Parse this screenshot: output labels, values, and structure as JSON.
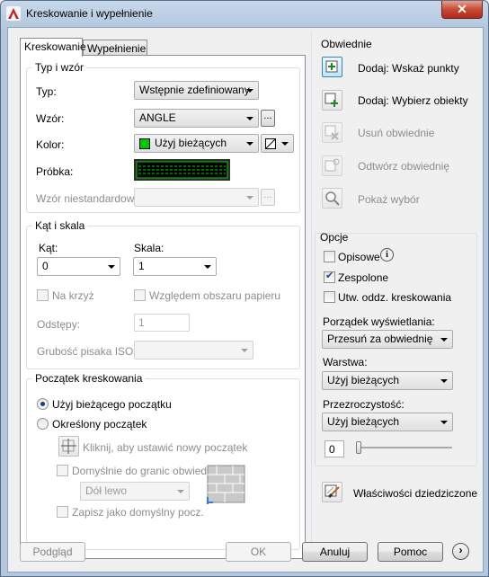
{
  "window": {
    "title": "Kreskowanie i wypełnienie",
    "close": "✕"
  },
  "tabs": [
    {
      "label": "Kreskowanie",
      "active": true
    },
    {
      "label": "Wypełnienie",
      "active": false
    }
  ],
  "type_pattern": {
    "group_title": "Typ i wzór",
    "type_label": "Typ:",
    "type_value": "Wstępnie zdefiniowany",
    "pattern_label": "Wzór:",
    "pattern_value": "ANGLE",
    "ellipsis": "...",
    "color_label": "Kolor:",
    "color_value": "Użyj bieżących",
    "color_swatch": "#00c800",
    "sample_label": "Próbka:",
    "custom_label": "Wzór niestandardowy:",
    "custom_value": ""
  },
  "angle_scale": {
    "group_title": "Kąt i skala",
    "angle_label": "Kąt:",
    "angle_value": "0",
    "scale_label": "Skala:",
    "scale_value": "1",
    "double_label": "Na krzyż",
    "relative_label": "Względem obszaru papieru",
    "spacing_label": "Odstępy:",
    "spacing_value": "1",
    "iso_label": "Grubość pisaka ISO:",
    "iso_value": ""
  },
  "origin": {
    "group_title": "Początek kreskowania",
    "current_label": "Użyj bieżącego początku",
    "specified_label": "Określony początek",
    "click_label": "Kliknij, aby ustawić nowy początek",
    "default_extents_label": "Domyślnie do granic obwiedni",
    "position_value": "Dół lewo",
    "store_label": "Zapisz jako domyślny pocz."
  },
  "boundaries": {
    "title": "Obwiednie",
    "items": [
      {
        "label": "Dodaj: Wskaż punkty",
        "enabled": true
      },
      {
        "label": "Dodaj: Wybierz obiekty",
        "enabled": true
      },
      {
        "label": "Usuń obwiednie",
        "enabled": false
      },
      {
        "label": "Odtwórz obwiednię",
        "enabled": false
      },
      {
        "label": "Pokaż wybór",
        "enabled": false
      }
    ]
  },
  "options": {
    "title": "Opcje",
    "annotative_label": "Opisowe",
    "associative_label": "Zespolone",
    "separate_label": "Utw. oddz. kreskowania",
    "draw_order_label": "Porządek wyświetlania:",
    "draw_order_value": "Przesuń za obwiednię",
    "layer_label": "Warstwa:",
    "layer_value": "Użyj bieżących",
    "transparency_label": "Przezroczystość:",
    "transparency_value": "Użyj bieżących",
    "transparency_number": "0"
  },
  "inherit": {
    "label": "Właściwości dziedziczone"
  },
  "footer": {
    "preview": "Podgląd",
    "ok": "OK",
    "cancel": "Anuluj",
    "help": "Pomoc",
    "more": "›"
  }
}
